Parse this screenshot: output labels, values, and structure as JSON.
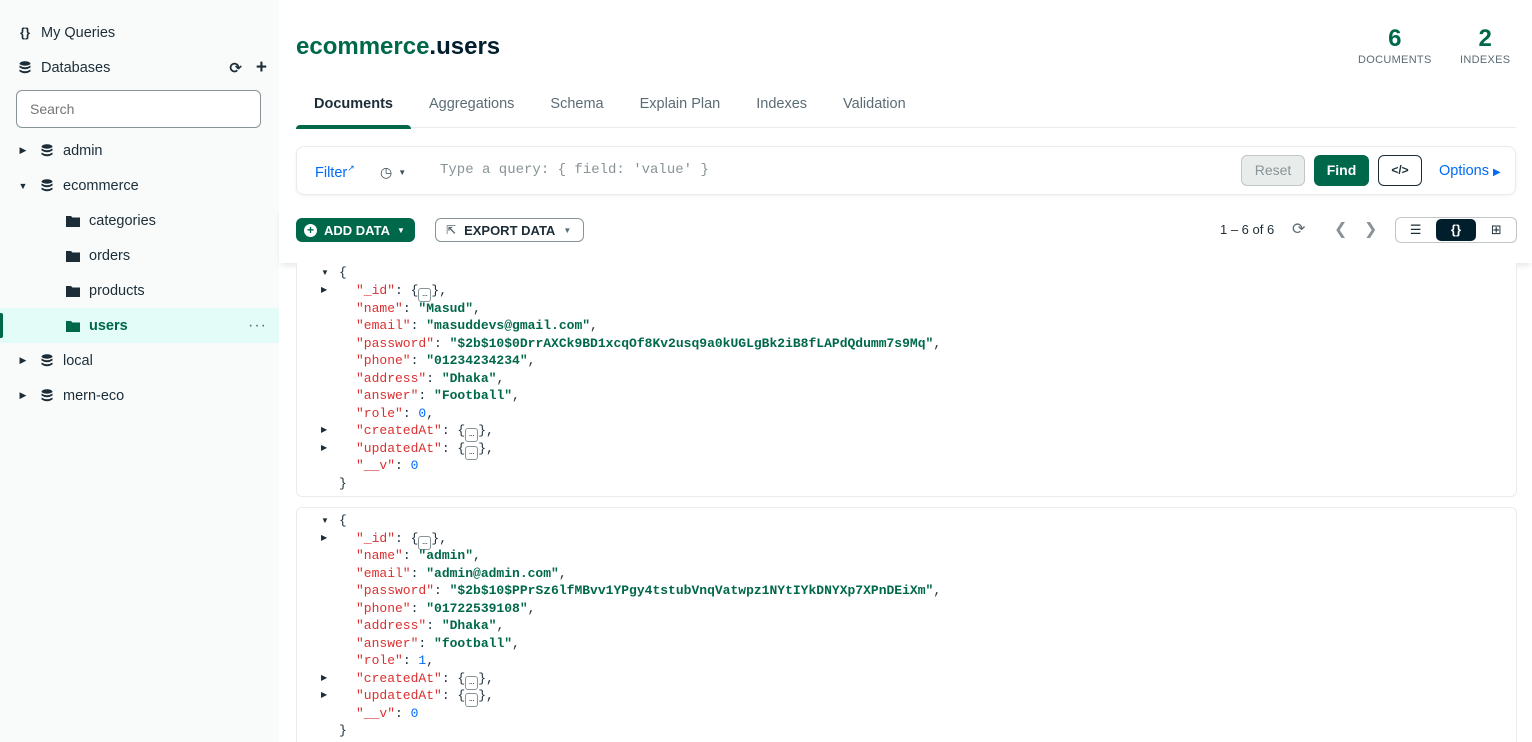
{
  "sidebar": {
    "my_queries": "My Queries",
    "databases": "Databases",
    "search_placeholder": "Search",
    "tree": [
      {
        "label": "admin",
        "expanded": false
      },
      {
        "label": "ecommerce",
        "expanded": true
      },
      {
        "label": "categories"
      },
      {
        "label": "orders"
      },
      {
        "label": "products"
      },
      {
        "label": "users",
        "active": true,
        "more": "···"
      },
      {
        "label": "local",
        "expanded": false
      },
      {
        "label": "mern-eco",
        "expanded": false
      }
    ]
  },
  "header": {
    "db": "ecommerce",
    "collection": ".users",
    "documents_count": "6",
    "documents_label": "DOCUMENTS",
    "indexes_count": "2",
    "indexes_label": "INDEXES"
  },
  "tabs": [
    "Documents",
    "Aggregations",
    "Schema",
    "Explain Plan",
    "Indexes",
    "Validation"
  ],
  "query": {
    "filter_label": "Filter",
    "placeholder": "Type a query: { field: 'value' }",
    "reset": "Reset",
    "find": "Find",
    "code": "</>",
    "options": "Options"
  },
  "toolbar": {
    "add_data": "ADD DATA",
    "export_data": "EXPORT DATA",
    "pager": "1 – 6 of 6"
  },
  "documents": [
    {
      "name": "\"Masud\"",
      "email": "\"masuddevs@gmail.com\"",
      "password": "\"$2b$10$0DrrAXCk9BD1xcqOf8Kv2usq9a0kUGLgBk2iB8fLAPdQdumm7s9Mq\"",
      "phone": "\"01234234234\"",
      "address": "\"Dhaka\"",
      "answer": "\"Football\"",
      "role": "0",
      "v": "0"
    },
    {
      "name": "\"admin\"",
      "email": "\"admin@admin.com\"",
      "password": "\"$2b$10$PPrSz6lfMBvv1YPgy4tstubVnqVatwpz1NYtIYkDNYXp7XPnDEiXm\"",
      "phone": "\"01722539108\"",
      "address": "\"Dhaka\"",
      "answer": "\"football\"",
      "role": "1",
      "v": "0"
    }
  ],
  "keys": {
    "id": "\"_id\"",
    "name": "\"name\"",
    "email": "\"email\"",
    "password": "\"password\"",
    "phone": "\"phone\"",
    "address": "\"address\"",
    "answer": "\"answer\"",
    "role": "\"role\"",
    "createdAt": "\"createdAt\"",
    "updatedAt": "\"updatedAt\"",
    "v": "\"__v\""
  }
}
